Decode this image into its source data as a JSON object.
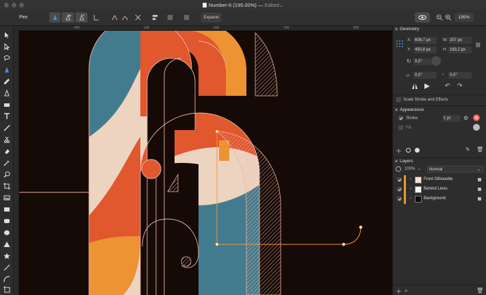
{
  "window": {
    "title": "Number-6 (195.00%)",
    "separator": "—",
    "status": "Edited"
  },
  "toolbar": {
    "tool_name": "Pen",
    "expand_label": "Expand",
    "zoom_value": "195%"
  },
  "rulers": {
    "top_ticks": [
      "400",
      "500",
      "600",
      "700",
      "800"
    ]
  },
  "geometry": {
    "title": "Geometry",
    "x_label": "X:",
    "x_value": "608,7 px",
    "y_label": "Y:",
    "y_value": "450,8 px",
    "w_label": "W:",
    "w_value": "207 px",
    "h_label": "H:",
    "h_value": "163,2 px",
    "rotation_value": "0,0°",
    "shear_value": "0,0°",
    "corner_value": "0,0°",
    "scale_stroke_label": "Scale Stroke and Effects"
  },
  "appearance": {
    "title": "Appearance",
    "stroke_label": "Stroke",
    "stroke_width": "1 pt",
    "fill_label": "Fill",
    "stroke_color": "#f3a7a0"
  },
  "layers": {
    "title": "Layers",
    "opacity_value": "100%",
    "blend_mode": "Normal",
    "items": [
      {
        "name": "Front Silhouette"
      },
      {
        "name": "Behind Lines"
      },
      {
        "name": "Background"
      }
    ]
  },
  "colors": {
    "teal": "#437b8e",
    "orange_red": "#e1572e",
    "orange": "#ed9334",
    "cream": "#ecd4c1",
    "dark": "#150a06",
    "outline": "#f1b3a4",
    "accent_layer": "#f0972e"
  }
}
